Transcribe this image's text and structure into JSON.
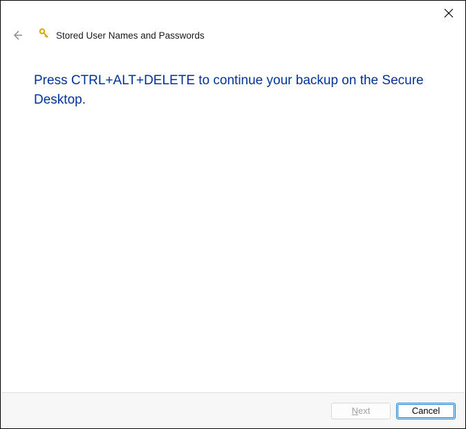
{
  "header": {
    "title": "Stored User Names and Passwords"
  },
  "content": {
    "instruction": "Press CTRL+ALT+DELETE to continue your backup on the Secure Desktop."
  },
  "footer": {
    "next_label_prefix": "N",
    "next_label_suffix": "ext",
    "cancel_label": "Cancel"
  }
}
